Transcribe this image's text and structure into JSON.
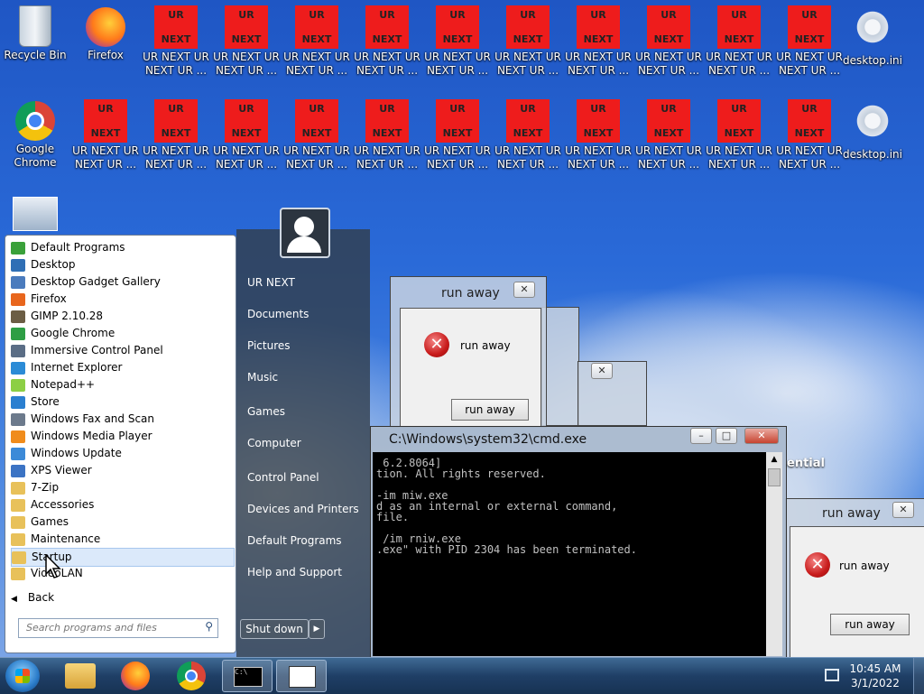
{
  "desktop": {
    "row1": [
      {
        "type": "recycle",
        "label": "Recycle Bin"
      },
      {
        "type": "firefox",
        "label": "Firefox"
      },
      {
        "type": "ur",
        "label": "UR NEXT UR NEXT UR ..."
      },
      {
        "type": "ur",
        "label": "UR NEXT UR NEXT UR ..."
      },
      {
        "type": "ur",
        "label": "UR NEXT UR NEXT UR ..."
      },
      {
        "type": "ur",
        "label": "UR NEXT UR NEXT UR ..."
      },
      {
        "type": "ur",
        "label": "UR NEXT UR NEXT UR ..."
      },
      {
        "type": "ur",
        "label": "UR NEXT UR NEXT UR ..."
      },
      {
        "type": "ur",
        "label": "UR NEXT UR NEXT UR ..."
      },
      {
        "type": "ur",
        "label": "UR NEXT UR NEXT UR ..."
      },
      {
        "type": "ur",
        "label": "UR NEXT UR NEXT UR ..."
      },
      {
        "type": "ur",
        "label": "UR NEXT UR NEXT UR ..."
      },
      {
        "type": "gear",
        "label": "desktop.ini"
      }
    ],
    "row2": [
      {
        "type": "chrome",
        "label": "Google Chrome"
      },
      {
        "type": "ur",
        "label": "UR NEXT UR NEXT UR ..."
      },
      {
        "type": "ur",
        "label": "UR NEXT UR NEXT UR ..."
      },
      {
        "type": "ur",
        "label": "UR NEXT UR NEXT UR ..."
      },
      {
        "type": "ur",
        "label": "UR NEXT UR NEXT UR ..."
      },
      {
        "type": "ur",
        "label": "UR NEXT UR NEXT UR ..."
      },
      {
        "type": "ur",
        "label": "UR NEXT UR NEXT UR ..."
      },
      {
        "type": "ur",
        "label": "UR NEXT UR NEXT UR ..."
      },
      {
        "type": "ur",
        "label": "UR NEXT UR NEXT UR ..."
      },
      {
        "type": "ur",
        "label": "UR NEXT UR NEXT UR ..."
      },
      {
        "type": "ur",
        "label": "UR NEXT UR NEXT UR ..."
      },
      {
        "type": "ur",
        "label": "UR NEXT UR NEXT UR ..."
      },
      {
        "type": "gear",
        "label": "desktop.ini"
      }
    ],
    "ur_top": "UR",
    "ur_bottom": "NEXT",
    "side_label": "ential"
  },
  "start_menu": {
    "programs": [
      {
        "label": "Default Programs",
        "color": "#3aa13a"
      },
      {
        "label": "Desktop",
        "color": "#2f6fb5"
      },
      {
        "label": "Desktop Gadget Gallery",
        "color": "#4a7bbd"
      },
      {
        "label": "Firefox",
        "color": "#e8661d"
      },
      {
        "label": "GIMP 2.10.28",
        "color": "#6b5d44"
      },
      {
        "label": "Google Chrome",
        "color": "#2e9e44"
      },
      {
        "label": "Immersive Control Panel",
        "color": "#5a6d85"
      },
      {
        "label": "Internet Explorer",
        "color": "#2b8bd6"
      },
      {
        "label": "Notepad++",
        "color": "#8ccf45"
      },
      {
        "label": "Store",
        "color": "#2a7fd0"
      },
      {
        "label": "Windows Fax and Scan",
        "color": "#6c7a8c"
      },
      {
        "label": "Windows Media Player",
        "color": "#f08c1c"
      },
      {
        "label": "Windows Update",
        "color": "#3c8ad8"
      },
      {
        "label": "XPS Viewer",
        "color": "#3b73c4"
      },
      {
        "label": "7-Zip",
        "color": "#e8c15a"
      },
      {
        "label": "Accessories",
        "color": "#e8c15a"
      },
      {
        "label": "Games",
        "color": "#e8c15a"
      },
      {
        "label": "Maintenance",
        "color": "#e8c15a"
      },
      {
        "label": "Startup",
        "color": "#e8c15a"
      },
      {
        "label": "VideoLAN",
        "color": "#e8c15a"
      }
    ],
    "back_label": "Back",
    "search_placeholder": "Search programs and files",
    "right_links": [
      "UR NEXT",
      "Documents",
      "Pictures",
      "Music",
      "Games",
      "Computer",
      "Control Panel",
      "Devices and Printers",
      "Default Programs",
      "Help and Support"
    ],
    "shutdown_label": "Shut down"
  },
  "dialogs": {
    "title": "run away",
    "message": "run away",
    "button": "run away"
  },
  "cmd": {
    "title": "C:\\Windows\\system32\\cmd.exe",
    "lines": [
      " 6.2.8064]",
      "tion. All rights reserved.",
      "",
      "-im miw.exe",
      "d as an internal or external command,",
      "file.",
      "",
      " /im rniw.exe",
      ".exe\" with PID 2304 has been terminated."
    ]
  },
  "taskbar": {
    "time": "10:45 AM",
    "date": "3/1/2022"
  }
}
